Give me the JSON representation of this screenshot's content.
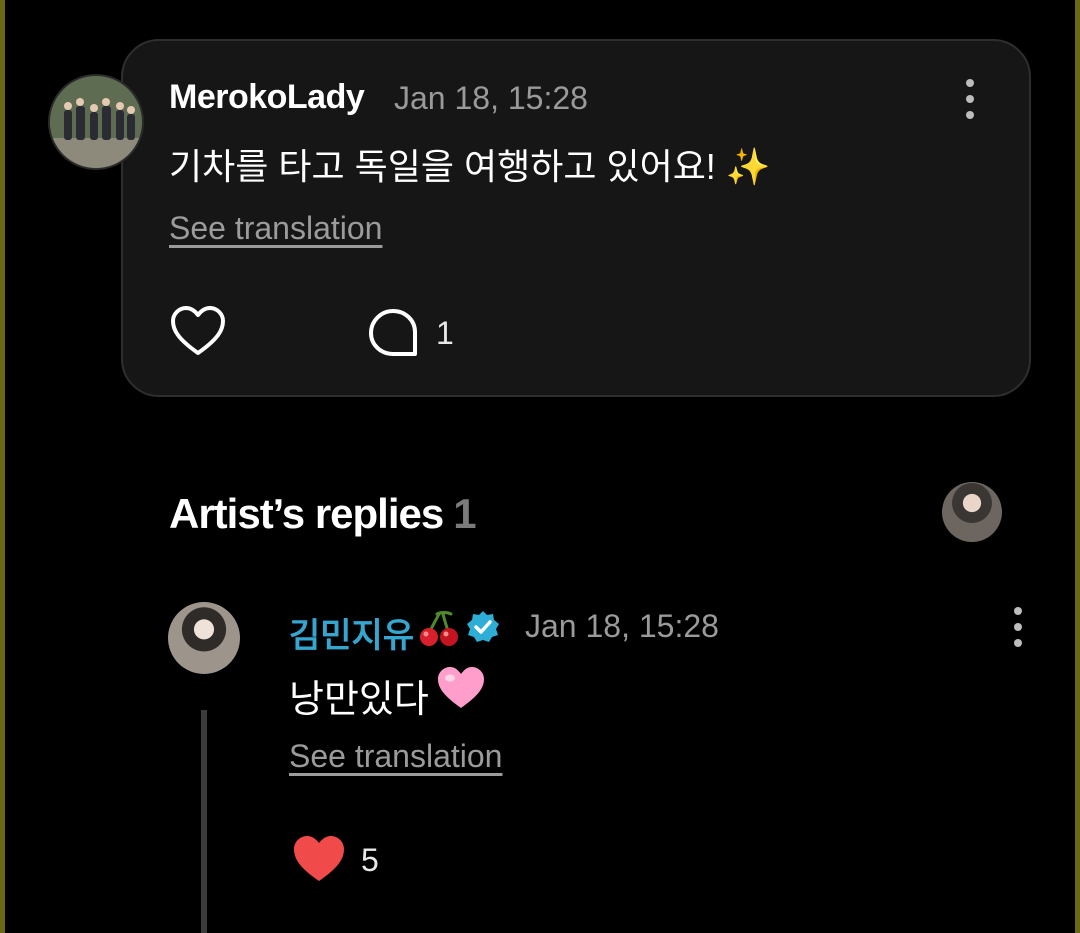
{
  "post": {
    "username": "MerokoLady",
    "timestamp": "Jan 18, 15:28",
    "text": "기차를 타고 독일을 여행하고 있어요! ✨",
    "translate_label": "See translation",
    "comment_count": "1"
  },
  "replies_section": {
    "title": "Artist’s replies",
    "count": "1"
  },
  "reply": {
    "username": "김민지유",
    "timestamp": "Jan 18, 15:28",
    "text": "낭만있다",
    "translate_label": "See translation",
    "like_count": "5"
  },
  "colors": {
    "background": "#000000",
    "card": "#161616",
    "artist_name": "#35a6cf",
    "like_red": "#f04a4a",
    "heart_pink": "#ff9ecb"
  },
  "icons": [
    "more-vertical-icon",
    "heart-outline-icon",
    "comment-bubble-icon",
    "cherry-icon",
    "verified-badge-icon",
    "pink-heart-emoji-icon",
    "heart-filled-icon"
  ]
}
